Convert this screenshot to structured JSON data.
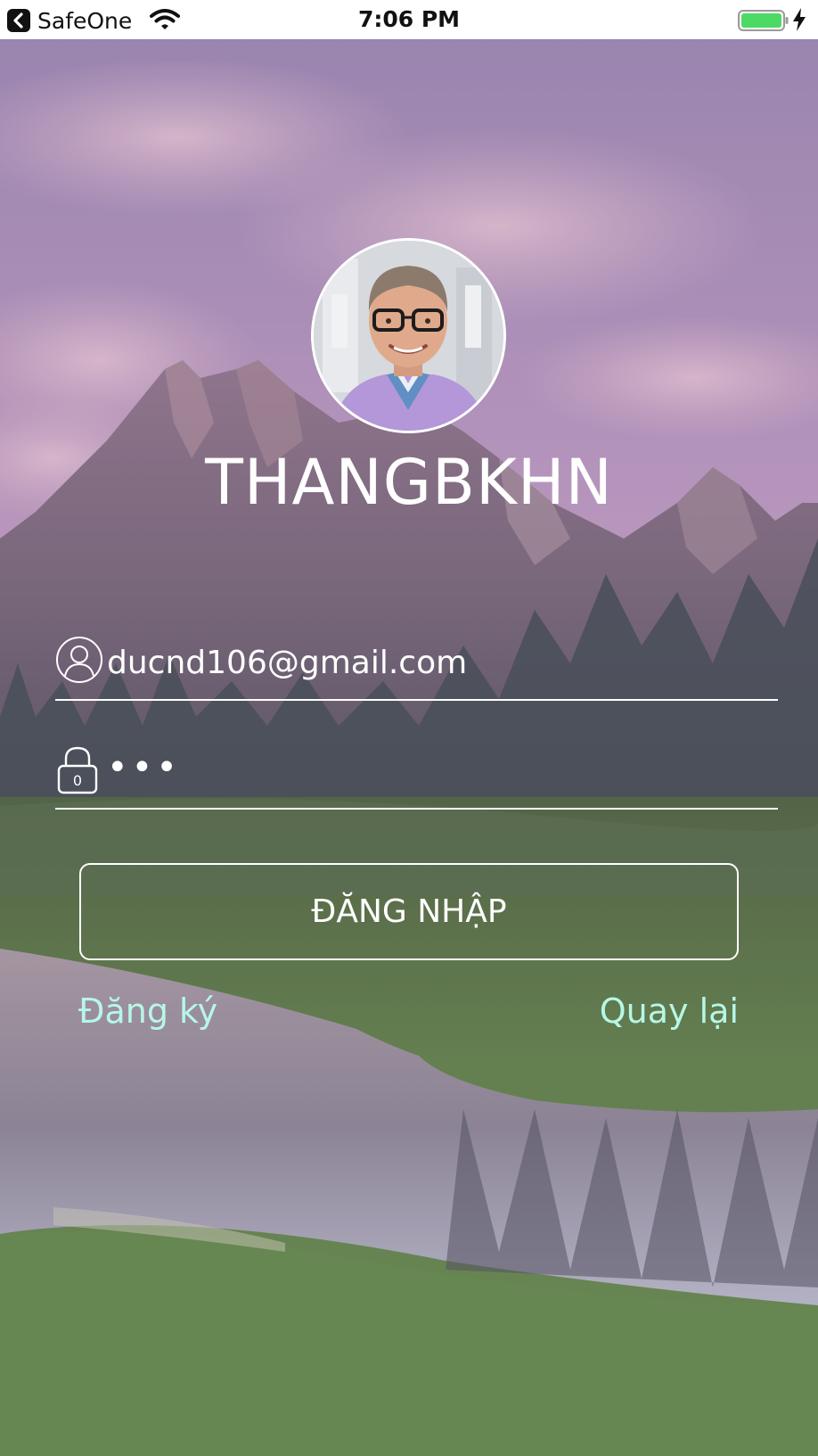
{
  "status_bar": {
    "back_app_name": "SafeOne",
    "time": "7:06 PM",
    "icons": [
      "back-chevron-icon",
      "wifi-icon",
      "battery-icon",
      "charging-bolt-icon"
    ],
    "battery_color": "#4cd964"
  },
  "profile": {
    "username": "THANGBKHN"
  },
  "login_form": {
    "email_value": "ducnd106@gmail.com",
    "password_value": "•••",
    "email_icon": "user-icon",
    "password_icon": "lock-icon",
    "lock_icon_digit": "0",
    "login_button_label": "ĐĂNG NHẬP"
  },
  "links": {
    "register_label": "Đăng ký",
    "back_label": "Quay lại",
    "link_color": "#b6f7e6"
  }
}
